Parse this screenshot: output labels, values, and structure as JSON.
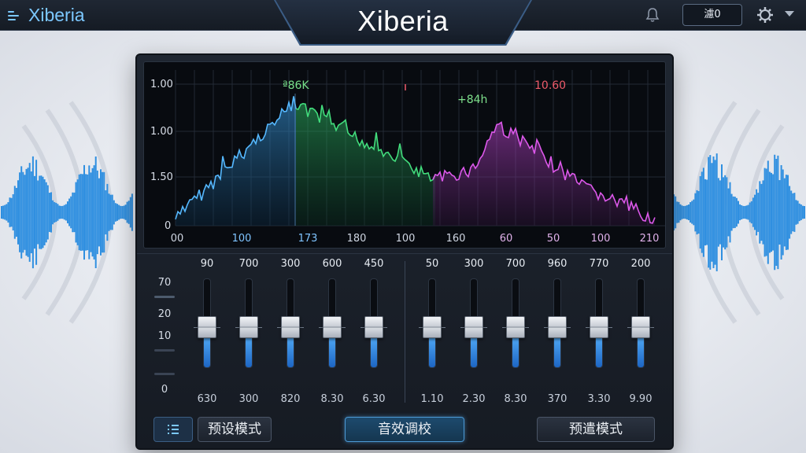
{
  "app": {
    "brand": "Xiberia",
    "title": "Xiberia",
    "top_button": "濾0",
    "icons": [
      "menu-icon",
      "bell-icon",
      "gear-icon",
      "caret-down-icon"
    ]
  },
  "spectrum": {
    "y_labels": [
      "1.00",
      "1.00",
      "1.50",
      "0"
    ],
    "x_labels": [
      "00",
      "100",
      "173",
      "180",
      "100",
      "160",
      "60",
      "50",
      "100",
      "210"
    ],
    "annotations": [
      {
        "text": "ª86K",
        "color": "#78e08a"
      },
      {
        "text": "+84h",
        "color": "#7ee08c"
      },
      {
        "text": "10.60",
        "color": "#ef5b6a"
      }
    ],
    "colors": {
      "blue": "#4fb3ff",
      "green": "#40d879",
      "magenta": "#d54fe0"
    }
  },
  "scale": {
    "labels": [
      "70",
      "20",
      "10",
      "0"
    ]
  },
  "faders": [
    {
      "top": "90",
      "bottom": "630",
      "level": 0.42
    },
    {
      "top": "700",
      "bottom": "300",
      "level": 0.42
    },
    {
      "top": "300",
      "bottom": "820",
      "level": 0.42
    },
    {
      "top": "600",
      "bottom": "8.30",
      "level": 0.42
    },
    {
      "top": "450",
      "bottom": "6.30",
      "level": 0.42
    },
    {
      "top": "50",
      "bottom": "1.10",
      "level": 0.42
    },
    {
      "top": "300",
      "bottom": "2.30",
      "level": 0.42
    },
    {
      "top": "700",
      "bottom": "8.30",
      "level": 0.42
    },
    {
      "top": "960",
      "bottom": "370",
      "level": 0.42
    },
    {
      "top": "770",
      "bottom": "3.30",
      "level": 0.42
    },
    {
      "top": "200",
      "bottom": "9.90",
      "level": 0.42
    }
  ],
  "buttons": {
    "preset_mode": "预设模式",
    "sound_tuning": "音效调校",
    "preview_mode": "预遣模式"
  }
}
